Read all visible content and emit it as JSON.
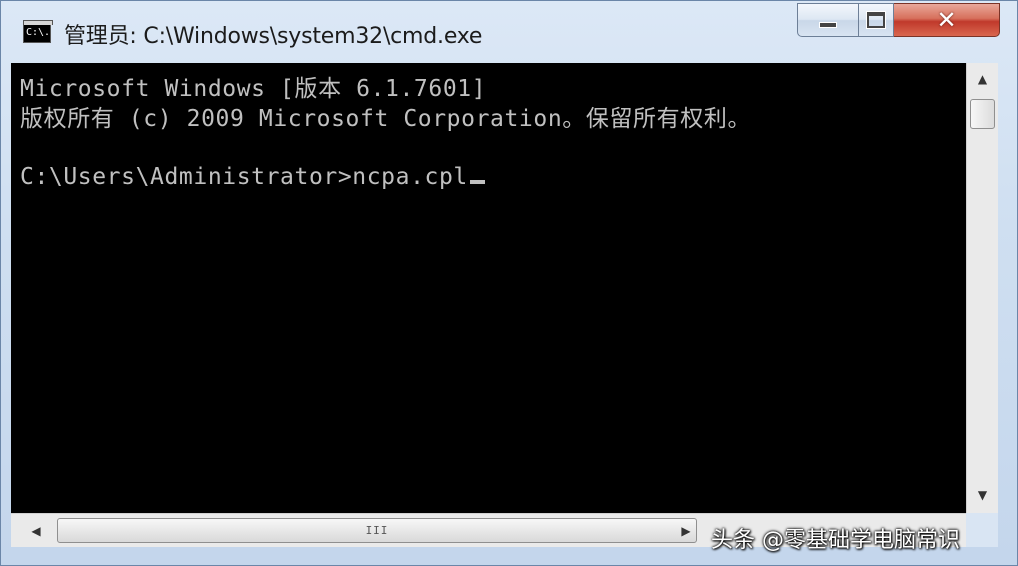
{
  "window": {
    "icon_text": "C:\\.",
    "title": "管理员: C:\\Windows\\system32\\cmd.exe",
    "buttons": {
      "minimize": "minimize-icon",
      "maximize": "maximize-icon",
      "close_symbol": "✕"
    }
  },
  "console": {
    "lines": [
      "Microsoft Windows [版本 6.1.7601]",
      "版权所有 (c) 2009 Microsoft Corporation。保留所有权利。",
      "",
      "C:\\Users\\Administrator>ncpa.cpl"
    ],
    "text_color": "#c0c0c0",
    "background": "#000000"
  },
  "scrollbars": {
    "up_arrow": "▲",
    "down_arrow": "▼",
    "left_arrow": "◀",
    "right_arrow": "▶",
    "h_thumb_grip": "III"
  },
  "watermark": "头条 @零基础学电脑常识"
}
